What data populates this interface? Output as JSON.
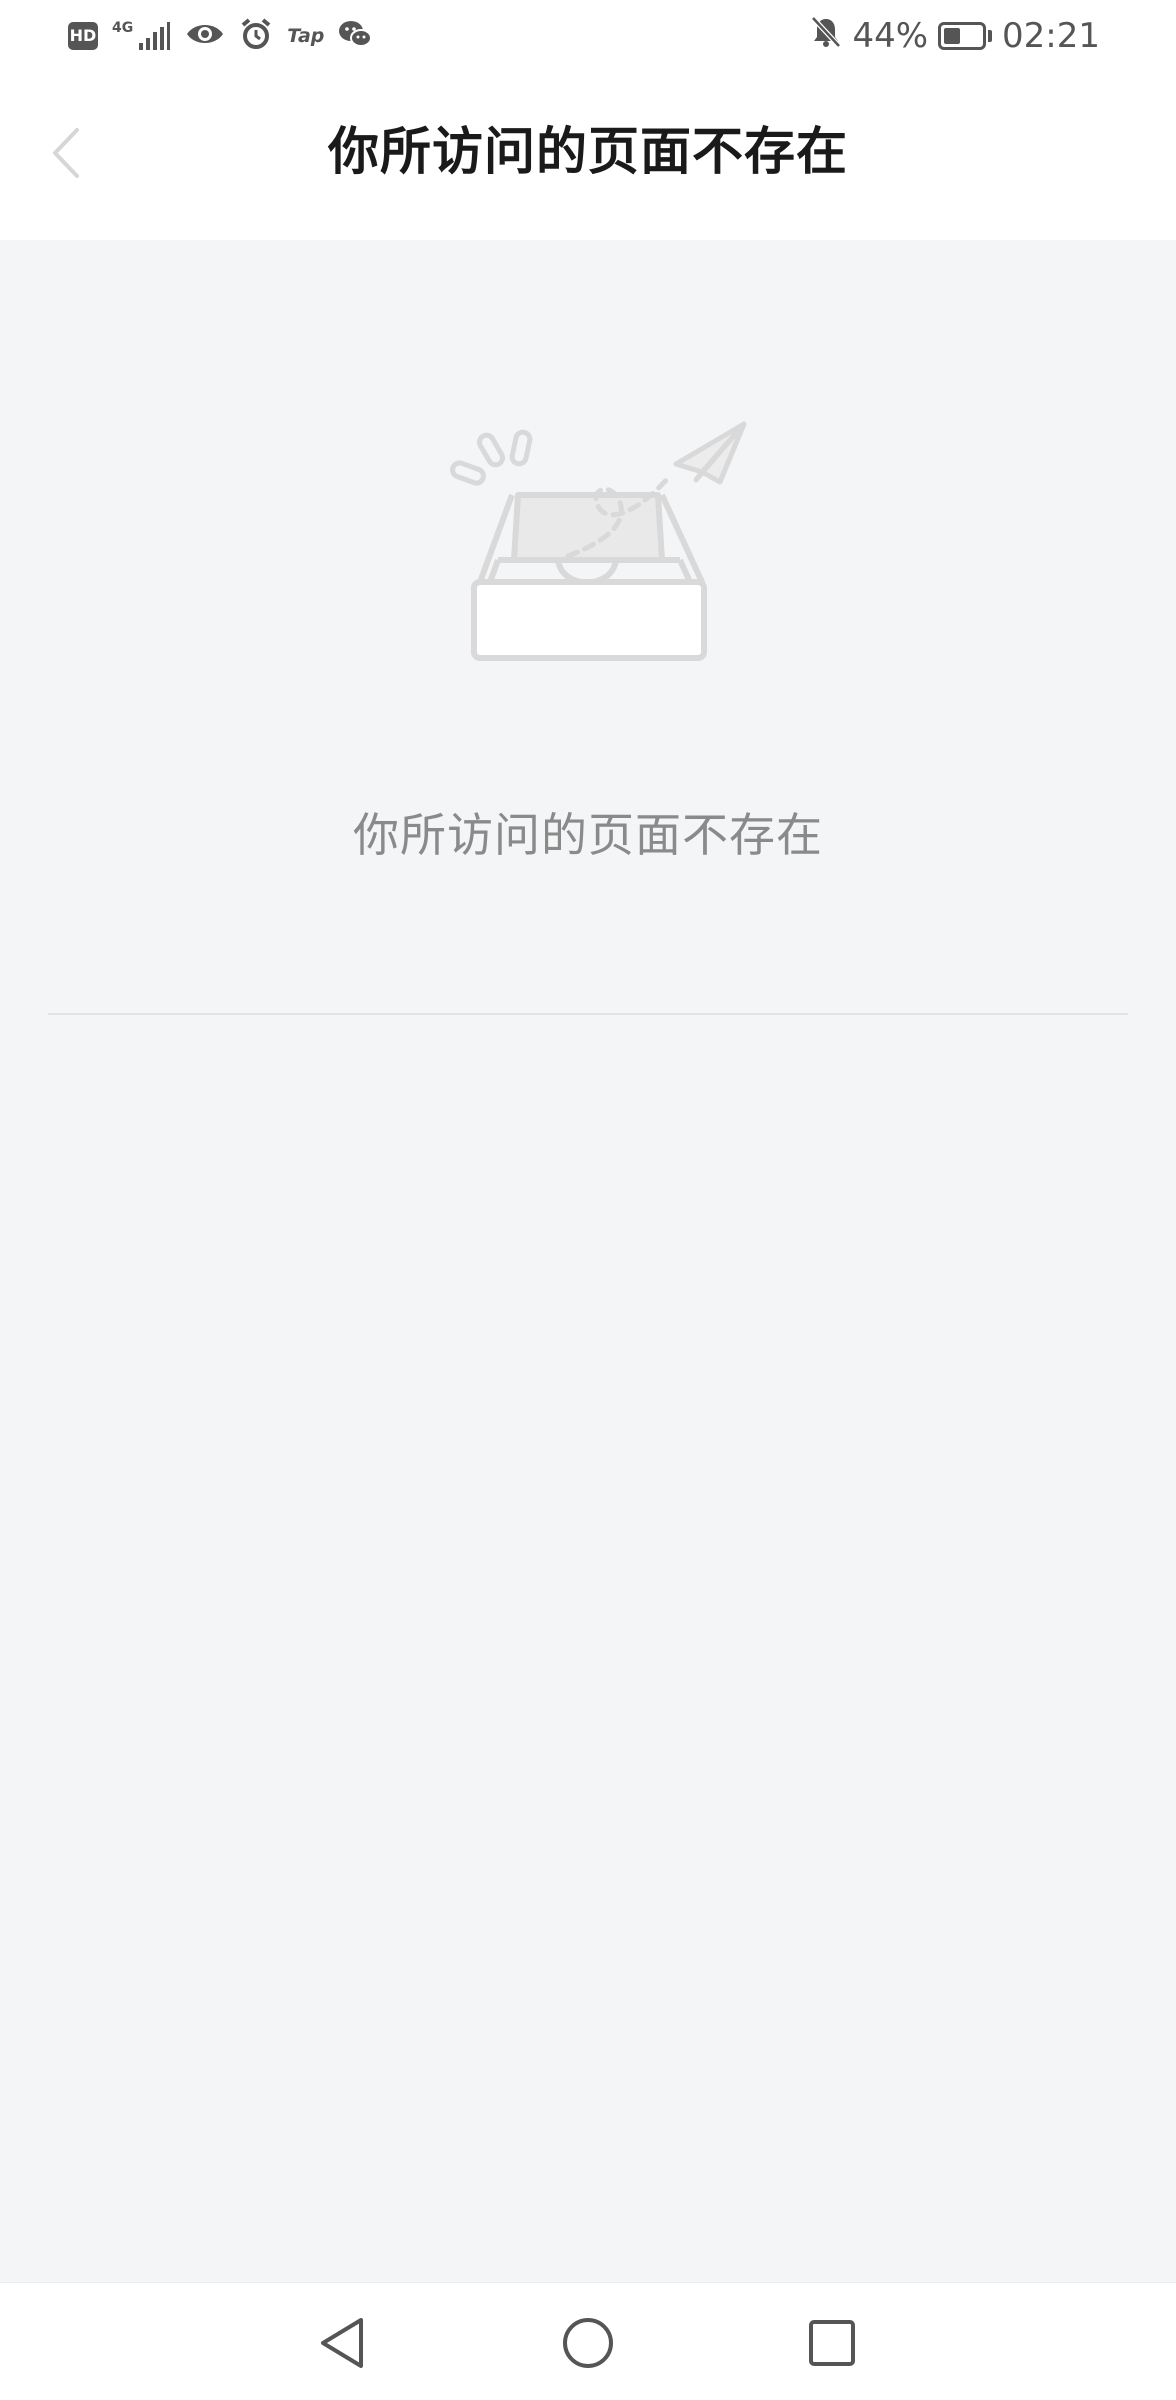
{
  "status_bar": {
    "network_label": "HD",
    "signal_label": "4G",
    "tap_label": "Tap",
    "battery_percent": "44%",
    "battery_level": 0.44,
    "time": "02:21"
  },
  "header": {
    "title": "你所访问的页面不存在"
  },
  "empty_state": {
    "message": "你所访问的页面不存在",
    "icon": "empty-inbox-paper-plane-icon"
  },
  "colors": {
    "background": "#f4f5f7",
    "title_text": "#1a1a1a",
    "message_text": "#8a8a8a",
    "illustration_stroke": "#d9d9d9"
  },
  "nav_bar": {
    "icons": [
      "nav-back-icon",
      "nav-home-icon",
      "nav-recent-icon"
    ]
  }
}
